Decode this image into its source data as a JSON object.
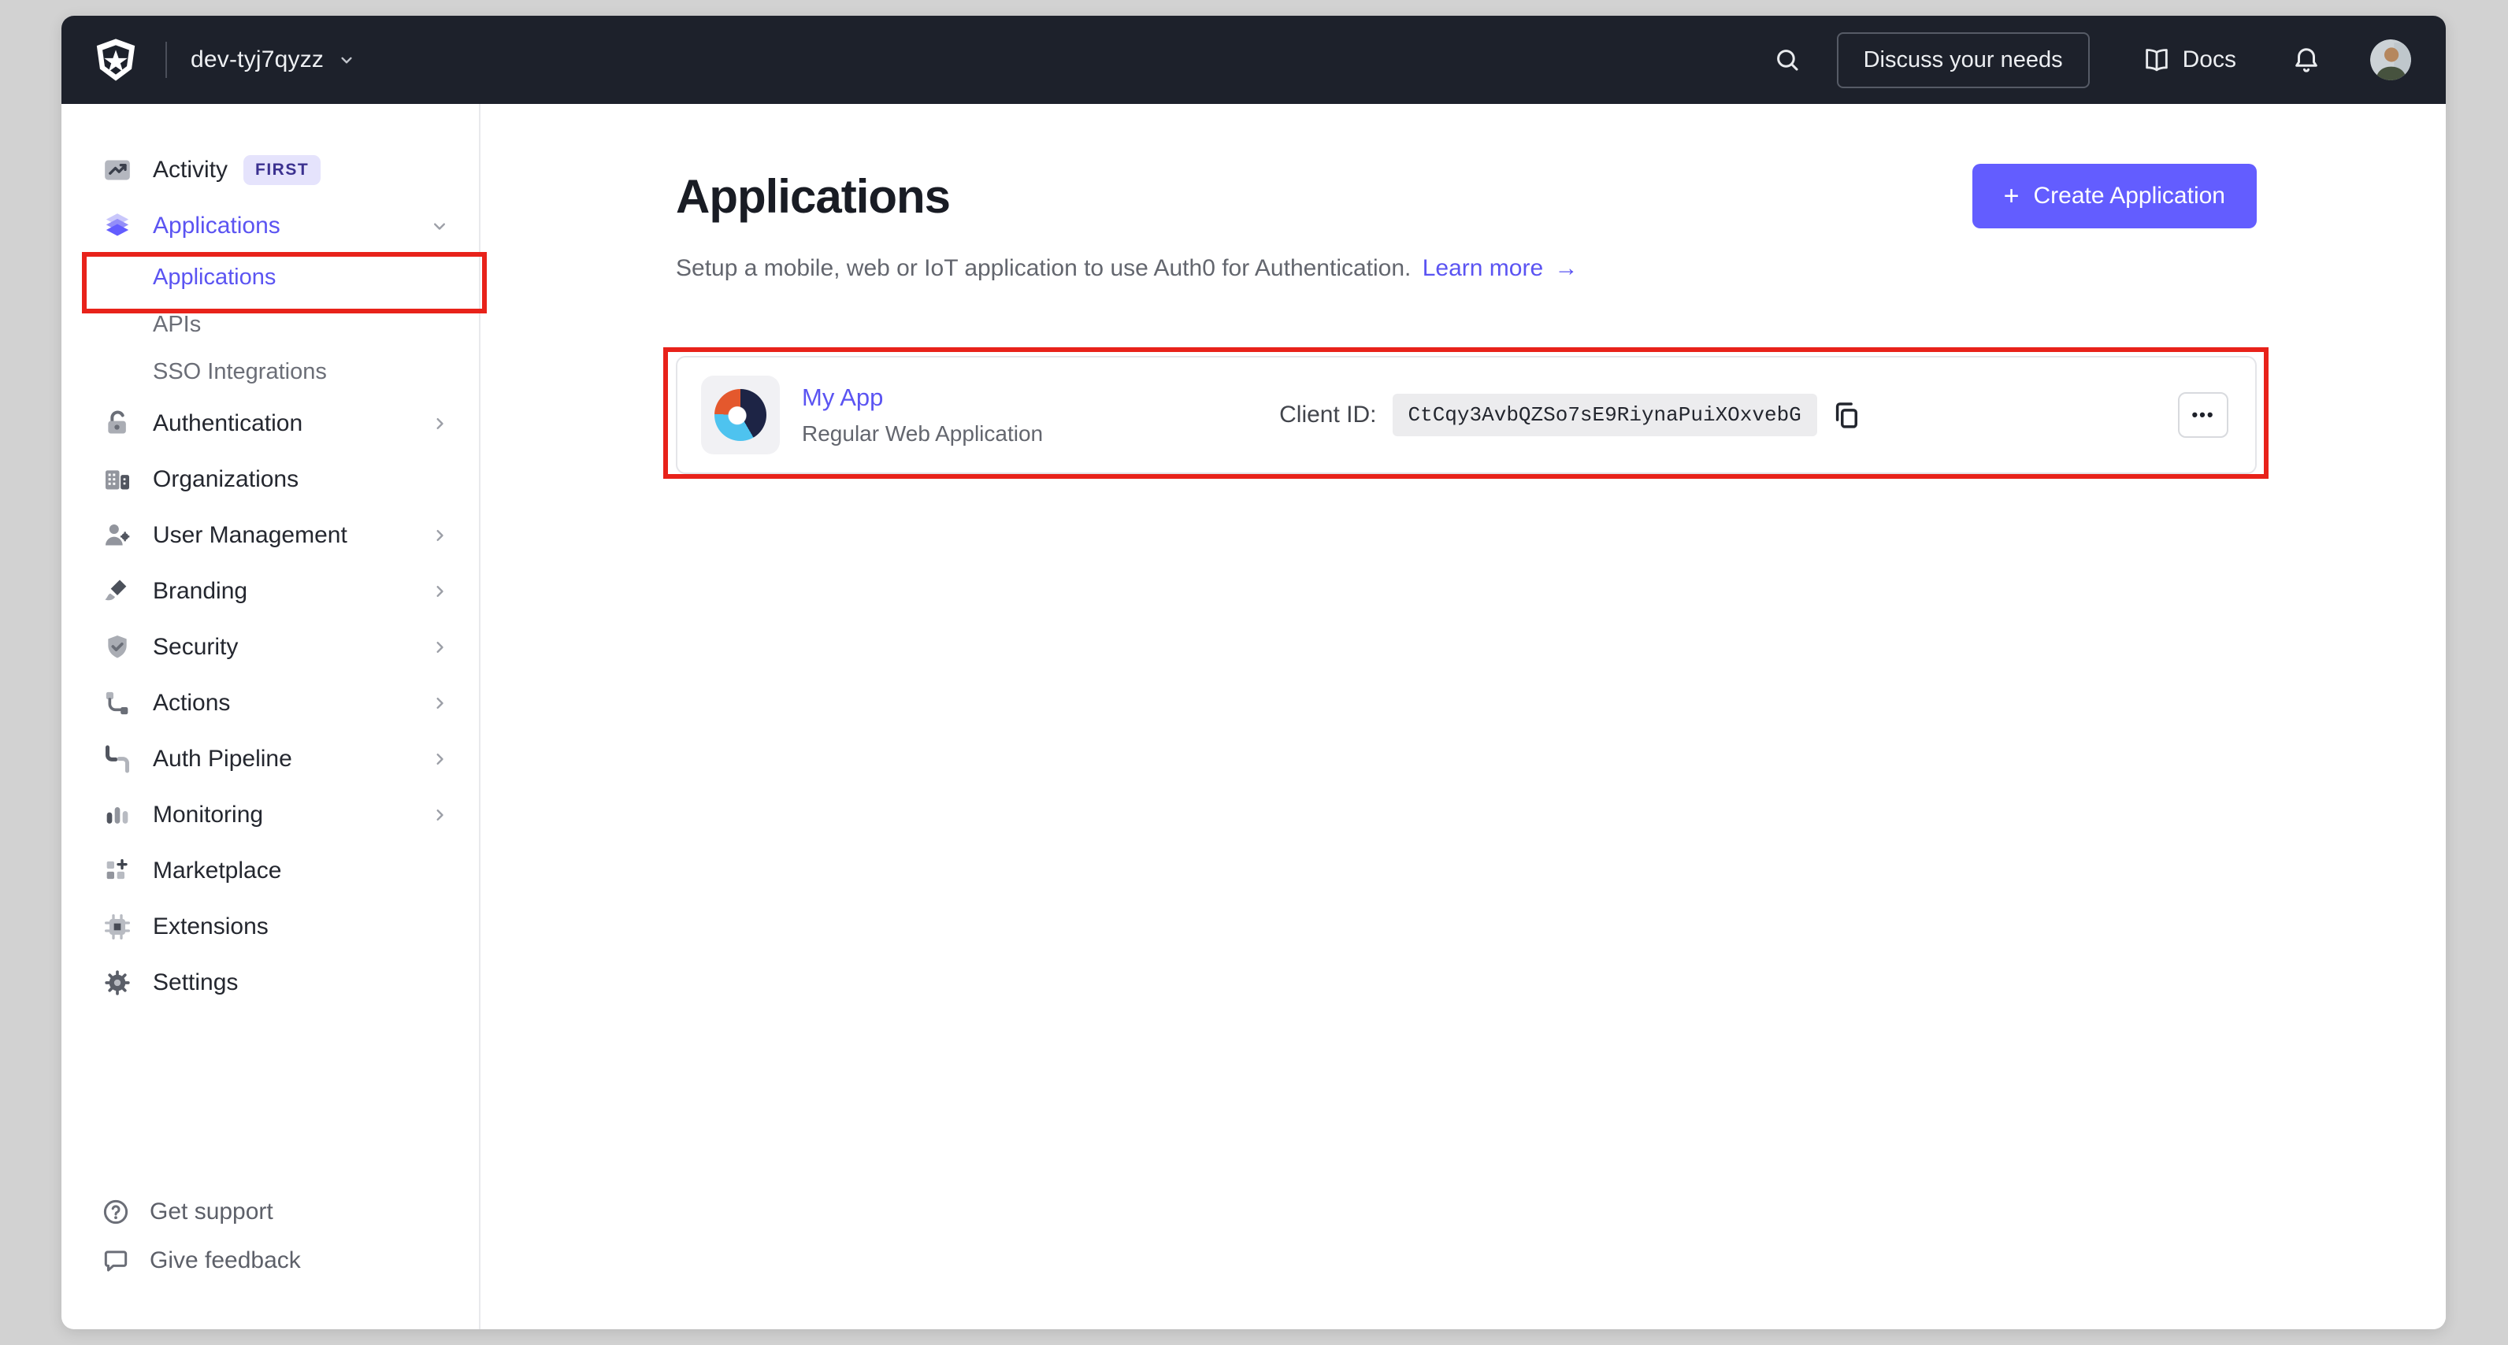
{
  "colors": {
    "accent": "#635dff",
    "link": "#5b54f2",
    "topbar_bg": "#1d212b",
    "annotation_red": "#e8221a",
    "badge_bg": "#e5e3fc",
    "badge_text": "#3b3190",
    "app_logo_orange": "#e4582d",
    "app_logo_navy": "#1d2445",
    "app_logo_blue": "#4ec3ef"
  },
  "header": {
    "tenant": "dev-tyj7qyzz",
    "discuss_button": "Discuss your needs",
    "docs_label": "Docs",
    "icons": [
      "auth0-shield-logo",
      "chevron-down-icon",
      "search-icon",
      "book-icon",
      "bell-icon",
      "avatar-photo"
    ]
  },
  "sidebar": {
    "items": [
      {
        "label": "Activity",
        "badge": "FIRST",
        "icon": "activity-icon"
      },
      {
        "label": "Applications",
        "icon": "layers-icon",
        "expanded": true,
        "active": true,
        "children": [
          {
            "label": "Applications",
            "active": true,
            "annotated": true
          },
          {
            "label": "APIs"
          },
          {
            "label": "SSO Integrations"
          }
        ]
      },
      {
        "label": "Authentication",
        "icon": "lock-icon",
        "chevron": true
      },
      {
        "label": "Organizations",
        "icon": "organization-icon"
      },
      {
        "label": "User Management",
        "icon": "user-gear-icon",
        "chevron": true
      },
      {
        "label": "Branding",
        "icon": "paintbrush-icon",
        "chevron": true
      },
      {
        "label": "Security",
        "icon": "shield-check-icon",
        "chevron": true
      },
      {
        "label": "Actions",
        "icon": "flow-icon",
        "chevron": true
      },
      {
        "label": "Auth Pipeline",
        "icon": "pipeline-icon",
        "chevron": true
      },
      {
        "label": "Monitoring",
        "icon": "bar-chart-icon",
        "chevron": true
      },
      {
        "label": "Marketplace",
        "icon": "grid-plus-icon"
      },
      {
        "label": "Extensions",
        "icon": "chip-icon"
      },
      {
        "label": "Settings",
        "icon": "gear-icon"
      }
    ],
    "footer": [
      {
        "label": "Get support",
        "icon": "help-circle-icon"
      },
      {
        "label": "Give feedback",
        "icon": "feedback-bubble-icon"
      }
    ]
  },
  "main": {
    "title": "Applications",
    "subtitle": "Setup a mobile, web or IoT application to use Auth0 for Authentication.",
    "learn_more": "Learn more",
    "learn_more_arrow": "→",
    "create_button": "Create Application",
    "create_plus": "+",
    "app_row": {
      "name": "My App",
      "type": "Regular Web Application",
      "client_id_label": "Client ID:",
      "client_id": "CtCqy3AvbQZSo7sE9RiynaPuiXOxvebG",
      "menu_dots": "•••",
      "icons": [
        "app-logo",
        "copy-icon",
        "ellipsis-menu-button"
      ]
    }
  }
}
